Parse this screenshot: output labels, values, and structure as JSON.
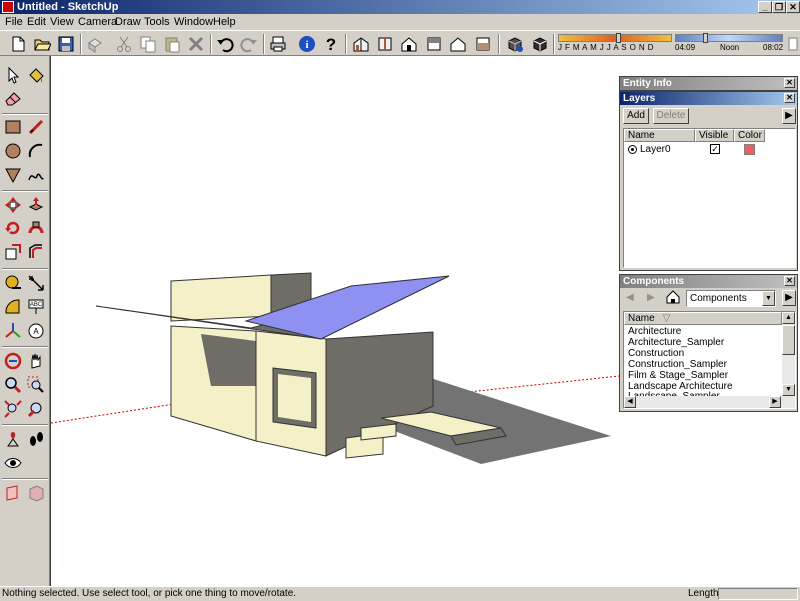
{
  "window": {
    "title": "Untitled - SketchUp",
    "controls": [
      "_",
      "❐",
      "✕"
    ]
  },
  "menu": [
    "File",
    "Edit",
    "View",
    "Camera",
    "Draw",
    "Tools",
    "Window",
    "Help"
  ],
  "toolbar": {
    "icons": [
      "new-icon",
      "open-icon",
      "save-icon",
      "make-component-icon",
      "cut-icon",
      "copy-icon",
      "paste-icon",
      "erase-icon",
      "undo-icon",
      "redo-icon",
      "print-icon",
      "model-info-icon",
      "help-icon",
      "iso-view-icon",
      "top-view-icon",
      "front-view-icon",
      "right-view-icon",
      "back-view-icon",
      "left-view-icon",
      "xray-icon",
      "back-edges-icon"
    ],
    "shadow_months": "J F M A M J J A S O N D",
    "shadow_time_start": "04:09",
    "shadow_time_mid": "Noon",
    "shadow_time_end": "08:02"
  },
  "left_toolbar": {
    "icons": [
      "select-icon",
      "paint-bucket-icon",
      "eraser-icon",
      "rectangle-icon",
      "line-icon",
      "circle-icon",
      "arc-icon",
      "polygon-icon",
      "freehand-icon",
      "move-icon",
      "push-pull-icon",
      "rotate-icon",
      "follow-me-icon",
      "scale-icon",
      "offset-icon",
      "tape-measure-icon",
      "dimension-icon",
      "protractor-icon",
      "text-icon",
      "axes-icon",
      "3d-text-icon",
      "orbit-icon",
      "pan-icon",
      "zoom-icon",
      "zoom-window-icon",
      "zoom-extents-icon",
      "previous-view-icon",
      "position-camera-icon",
      "walk-icon",
      "look-around-icon",
      "section-plane-icon",
      "section-display-icon"
    ]
  },
  "entity_info": {
    "title": "Entity Info"
  },
  "layers": {
    "title": "Layers",
    "add_label": "Add",
    "delete_label": "Delete",
    "col_name": "Name",
    "col_visible": "Visible",
    "col_color": "Color",
    "rows": [
      {
        "name": "Layer0",
        "visible": true,
        "color": "#f06060"
      }
    ]
  },
  "components": {
    "title": "Components",
    "selected": "Components",
    "col_name": "Name",
    "items": [
      "Architecture",
      "Architecture_Sampler",
      "Construction",
      "Construction_Sampler",
      "Film & Stage_Sampler",
      "Landscape Architecture",
      "Landscape_Sampler"
    ]
  },
  "status": {
    "message": "Nothing selected. Use select tool, or pick one thing to move/rotate.",
    "length_label": "Length",
    "length_value": ""
  },
  "colors": {
    "title_active": "#0a246a",
    "roof": "#8f91f2",
    "wall_light": "#f4f0c8",
    "wall_shadow": "#6f6e66",
    "ground_shadow": "#737373",
    "axis_red": "#cc0000"
  }
}
